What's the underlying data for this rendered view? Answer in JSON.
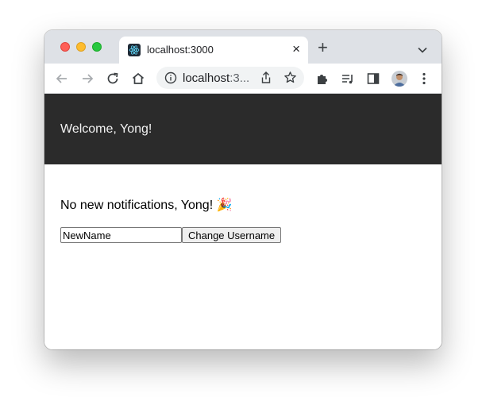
{
  "browser": {
    "tab": {
      "title": "localhost:3000",
      "close_glyph": "×"
    },
    "new_tab_glyph": "+",
    "omnibox": {
      "host": "localhost",
      "rest": ":3..."
    },
    "accent": "#202124"
  },
  "app": {
    "header_bg": "#2b2b2b",
    "welcome": "Welcome, Yong!",
    "notification": "No new notifications, Yong!",
    "notification_emoji": "🎉",
    "username_input_value": "NewName",
    "change_button_label": "Change Username"
  }
}
